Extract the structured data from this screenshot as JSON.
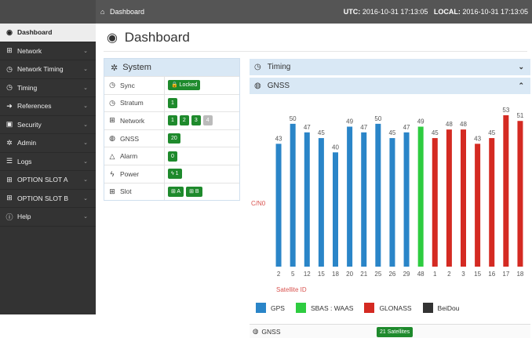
{
  "topbar": {
    "home_icon": "home-icon",
    "breadcrumb": "Dashboard",
    "utc_label": "UTC:",
    "utc_value": "2016-10-31 17:13:05",
    "local_label": "LOCAL:",
    "local_value": "2016-10-31 17:13:05"
  },
  "sidebar": {
    "items": [
      {
        "label": "Dashboard",
        "icon": "dashboard-icon",
        "glyph": "◉",
        "active": true,
        "chevron": false
      },
      {
        "label": "Network",
        "icon": "network-icon",
        "glyph": "⊞",
        "chevron": true
      },
      {
        "label": "Network Timing",
        "icon": "clock-icon",
        "glyph": "◷",
        "chevron": true
      },
      {
        "label": "Timing",
        "icon": "clock-icon",
        "glyph": "◷",
        "chevron": true
      },
      {
        "label": "References",
        "icon": "sign-in-icon",
        "glyph": "➜",
        "chevron": true
      },
      {
        "label": "Security",
        "icon": "lock-icon",
        "glyph": "▣",
        "chevron": true
      },
      {
        "label": "Admin",
        "icon": "gear-icon",
        "glyph": "✲",
        "chevron": true
      },
      {
        "label": "Logs",
        "icon": "list-icon",
        "glyph": "☰",
        "chevron": true
      },
      {
        "label": "OPTION SLOT A",
        "icon": "plus-square-icon",
        "glyph": "⊞",
        "chevron": true
      },
      {
        "label": "OPTION SLOT B",
        "icon": "plus-square-icon",
        "glyph": "⊞",
        "chevron": true
      },
      {
        "label": "Help",
        "icon": "info-icon",
        "glyph": "ⓘ",
        "chevron": true
      }
    ]
  },
  "main": {
    "title": "Dashboard",
    "title_icon": "dashboard-icon"
  },
  "system_panel": {
    "title": "System",
    "title_icon": "gears-icon",
    "rows": [
      {
        "label": "Sync",
        "icon": "clock-icon",
        "glyph": "◷",
        "values": [
          "🔒 Locked"
        ],
        "grey": []
      },
      {
        "label": "Stratum",
        "icon": "clock-icon",
        "glyph": "◷",
        "values": [
          "1"
        ],
        "grey": []
      },
      {
        "label": "Network",
        "icon": "network-icon",
        "glyph": "⊞",
        "values": [
          "1",
          "2",
          "3",
          "4"
        ],
        "grey": [
          3
        ]
      },
      {
        "label": "GNSS",
        "icon": "globe-icon",
        "glyph": "◍",
        "values": [
          "20"
        ],
        "grey": []
      },
      {
        "label": "Alarm",
        "icon": "bell-icon",
        "glyph": "△",
        "values": [
          "0"
        ],
        "grey": []
      },
      {
        "label": "Power",
        "icon": "bolt-icon",
        "glyph": "ϟ",
        "values": [
          "ϟ 1"
        ],
        "grey": []
      },
      {
        "label": "Slot",
        "icon": "plus-square-icon",
        "glyph": "⊞",
        "values": [
          "⊞ A",
          "⊞ B"
        ],
        "grey": []
      }
    ]
  },
  "timing_panel": {
    "title": "Timing",
    "icon": "clock-icon",
    "chevron": "⌄"
  },
  "gnss_panel": {
    "title": "GNSS",
    "icon": "globe-icon",
    "chevron": "⌃"
  },
  "colors": {
    "GPS": "#2a85c8",
    "SBAS : WAAS": "#2ecc40",
    "GLONASS": "#d42a22",
    "BeiDou": "#333333",
    "ylabel": "#d9534f",
    "xlabel": "#d9534f"
  },
  "chart_data": {
    "type": "bar",
    "ylabel": "C/N0",
    "xlabel": "Satellite ID",
    "ylim": [
      0,
      56
    ],
    "categories": [
      "2",
      "5",
      "12",
      "15",
      "18",
      "20",
      "21",
      "25",
      "26",
      "29",
      "48",
      "1",
      "2",
      "3",
      "15",
      "16",
      "17",
      "18"
    ],
    "values": [
      43,
      50,
      47,
      45,
      40,
      49,
      47,
      50,
      45,
      47,
      49,
      45,
      48,
      48,
      43,
      45,
      53,
      51
    ],
    "systems": [
      "GPS",
      "GPS",
      "GPS",
      "GPS",
      "GPS",
      "GPS",
      "GPS",
      "GPS",
      "GPS",
      "GPS",
      "SBAS : WAAS",
      "GLONASS",
      "GLONASS",
      "GLONASS",
      "GLONASS",
      "GLONASS",
      "GLONASS",
      "GLONASS"
    ],
    "legend": [
      "GPS",
      "SBAS : WAAS",
      "GLONASS",
      "BeiDou"
    ]
  },
  "gnss_footer": {
    "label": "GNSS",
    "icon": "globe-icon",
    "badge": "21 Satellites"
  }
}
